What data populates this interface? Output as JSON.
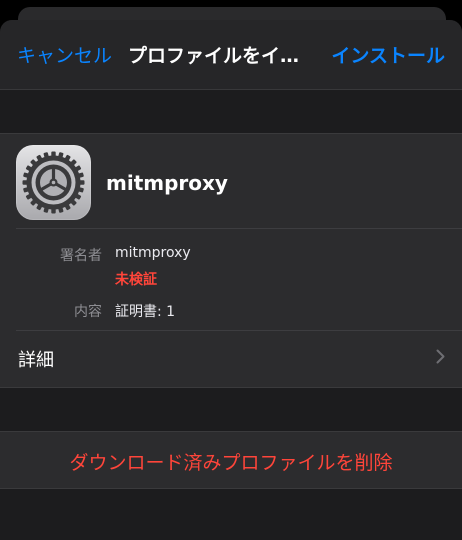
{
  "navbar": {
    "cancel_label": "キャンセル",
    "title": "プロファイルをイ…",
    "install_label": "インストール"
  },
  "profile": {
    "icon": "settings-gear-icon",
    "name": "mitmproxy",
    "signed_by_label": "署名者",
    "signed_by_value": "mitmproxy",
    "verification_status": "未検証",
    "contains_label": "内容",
    "contains_value": "証明書: 1",
    "more_details_label": "詳細"
  },
  "delete_action": {
    "label": "ダウンロード済みプロファイルを削除"
  },
  "colors": {
    "accent_blue": "#0a84ff",
    "destructive_red": "#ff453a",
    "sheet_background": "#1c1c1e",
    "group_background": "#2c2c2e"
  }
}
